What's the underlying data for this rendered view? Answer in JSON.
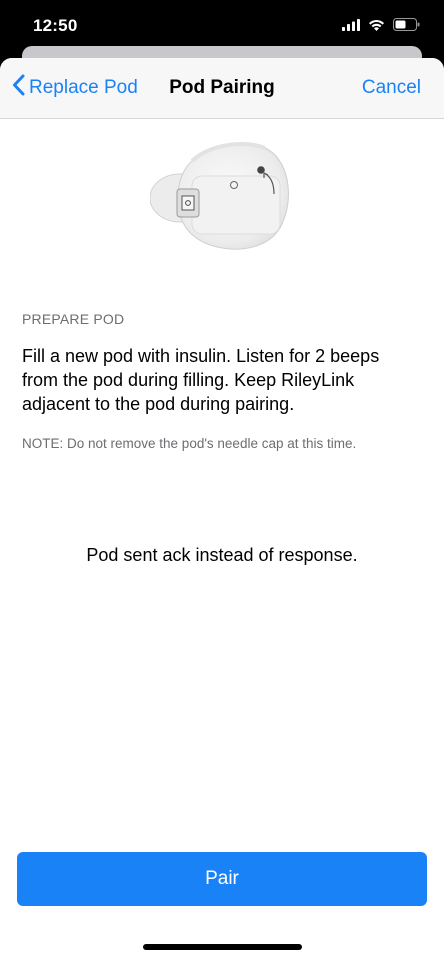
{
  "status_bar": {
    "time": "12:50",
    "icons": [
      "cellular-signal-icon",
      "wifi-icon",
      "battery-icon"
    ]
  },
  "nav": {
    "back_label": "Replace Pod",
    "title": "Pod Pairing",
    "cancel_label": "Cancel"
  },
  "content": {
    "section_header": "PREPARE POD",
    "instructions": "Fill a new pod with insulin. Listen for 2 beeps from the pod during filling. Keep RileyLink adjacent to the pod during pairing.",
    "note": "NOTE: Do not remove the pod's needle cap at this time.",
    "status_message": "Pod sent ack instead of response."
  },
  "actions": {
    "pair_label": "Pair"
  },
  "colors": {
    "accent": "#1a82f7",
    "secondary_text": "#6d6d72",
    "nav_background": "#f7f7f7"
  }
}
